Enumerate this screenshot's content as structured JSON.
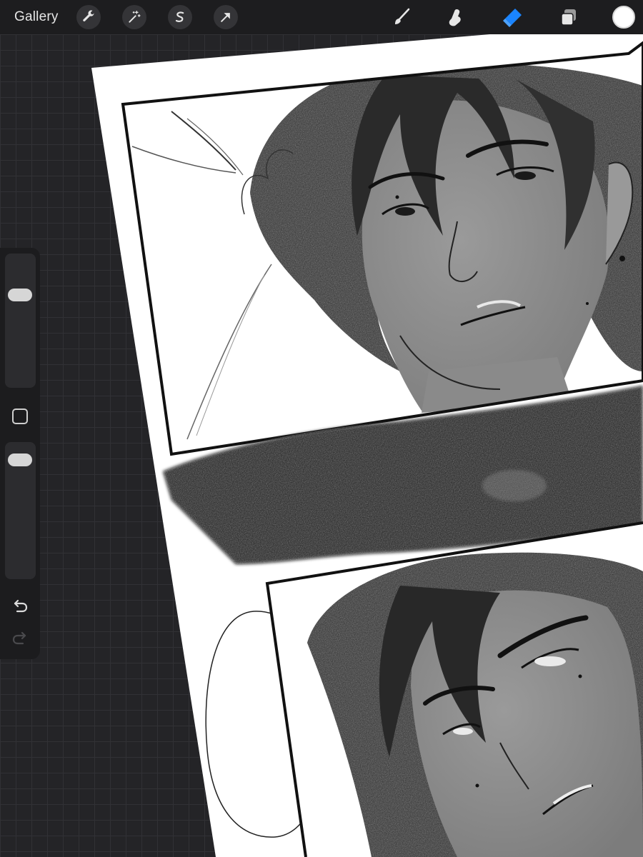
{
  "app": {
    "gallery_label": "Gallery"
  },
  "toolbar": {
    "left_tools": [
      {
        "name": "actions",
        "icon": "wrench-icon"
      },
      {
        "name": "adjustments",
        "icon": "magic-wand-icon"
      },
      {
        "name": "selection",
        "icon": "selection-s-icon"
      },
      {
        "name": "transform",
        "icon": "arrow-cursor-icon"
      }
    ],
    "right_tools": [
      {
        "name": "brush",
        "icon": "brush-icon",
        "active": false
      },
      {
        "name": "smudge",
        "icon": "smudge-finger-icon",
        "active": false
      },
      {
        "name": "eraser",
        "icon": "eraser-icon",
        "active": true
      },
      {
        "name": "layers",
        "icon": "layers-icon",
        "active": false
      }
    ],
    "current_color": "#ffffff",
    "active_tool_color": "#1a84ff"
  },
  "sidebar": {
    "brush_size_level": 0.72,
    "opacity_level": 0.93,
    "buttons": [
      {
        "name": "modify",
        "icon": "square-modify-icon"
      },
      {
        "name": "undo",
        "icon": "undo-arrow-icon",
        "enabled": true
      },
      {
        "name": "redo",
        "icon": "redo-arrow-icon",
        "enabled": false
      }
    ]
  },
  "canvas": {
    "content": "comic-page",
    "panels": 2,
    "speech_bubble_text": ""
  }
}
